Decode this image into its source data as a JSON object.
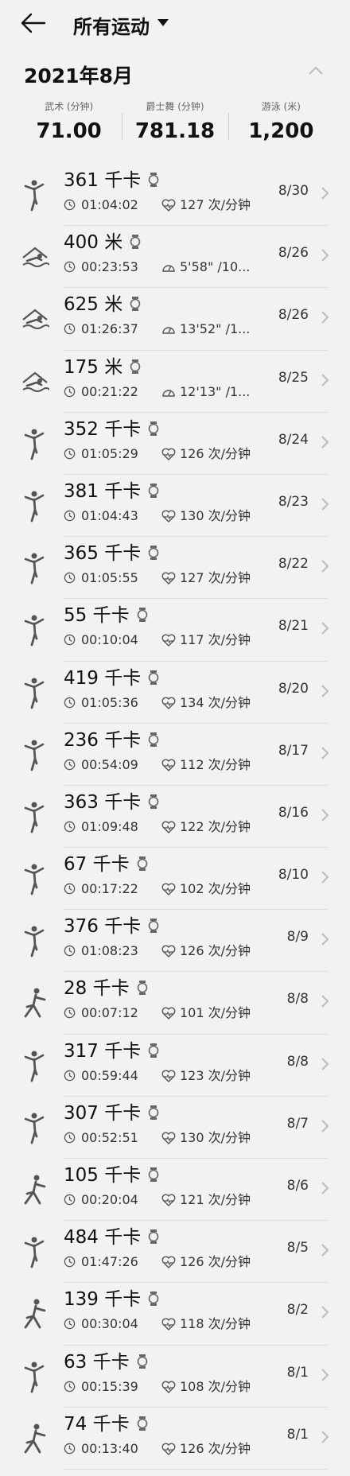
{
  "header": {
    "title": "所有运动",
    "back_icon": "arrow-left-icon",
    "dropdown_icon": "caret-down-icon"
  },
  "month": {
    "label": "2021年8月",
    "collapse_icon": "chevron-up-icon"
  },
  "summary": [
    {
      "label": "武术 (分钟)",
      "value": "71.00"
    },
    {
      "label": "爵士舞 (分钟)",
      "value": "781.18"
    },
    {
      "label": "游泳 (米)",
      "value": "1,200"
    }
  ],
  "records": [
    {
      "type": "dance",
      "metric": "361 千卡",
      "duration": "01:04:02",
      "secondary": "127 次/分钟",
      "date": "8/30"
    },
    {
      "type": "swim",
      "metric": "400 米",
      "duration": "00:23:53",
      "secondary": "5'58\" /10...",
      "date": "8/26"
    },
    {
      "type": "swim",
      "metric": "625 米",
      "duration": "01:26:37",
      "secondary": "13'52\" /1...",
      "date": "8/26"
    },
    {
      "type": "swim",
      "metric": "175 米",
      "duration": "00:21:22",
      "secondary": "12'13\" /1...",
      "date": "8/25"
    },
    {
      "type": "dance",
      "metric": "352 千卡",
      "duration": "01:05:29",
      "secondary": "126 次/分钟",
      "date": "8/24"
    },
    {
      "type": "dance",
      "metric": "381 千卡",
      "duration": "01:04:43",
      "secondary": "130 次/分钟",
      "date": "8/23"
    },
    {
      "type": "dance",
      "metric": "365 千卡",
      "duration": "01:05:55",
      "secondary": "127 次/分钟",
      "date": "8/22"
    },
    {
      "type": "dance",
      "metric": "55 千卡",
      "duration": "00:10:04",
      "secondary": "117 次/分钟",
      "date": "8/21"
    },
    {
      "type": "dance",
      "metric": "419 千卡",
      "duration": "01:05:36",
      "secondary": "134 次/分钟",
      "date": "8/20"
    },
    {
      "type": "dance",
      "metric": "236 千卡",
      "duration": "00:54:09",
      "secondary": "112 次/分钟",
      "date": "8/17"
    },
    {
      "type": "dance",
      "metric": "363 千卡",
      "duration": "01:09:48",
      "secondary": "122 次/分钟",
      "date": "8/16"
    },
    {
      "type": "dance",
      "metric": "67 千卡",
      "duration": "00:17:22",
      "secondary": "102 次/分钟",
      "date": "8/10"
    },
    {
      "type": "dance",
      "metric": "376 千卡",
      "duration": "01:08:23",
      "secondary": "126 次/分钟",
      "date": "8/9"
    },
    {
      "type": "martial",
      "metric": "28 千卡",
      "duration": "00:07:12",
      "secondary": "101 次/分钟",
      "date": "8/8"
    },
    {
      "type": "dance",
      "metric": "317 千卡",
      "duration": "00:59:44",
      "secondary": "123 次/分钟",
      "date": "8/8"
    },
    {
      "type": "dance",
      "metric": "307 千卡",
      "duration": "00:52:51",
      "secondary": "130 次/分钟",
      "date": "8/7"
    },
    {
      "type": "martial",
      "metric": "105 千卡",
      "duration": "00:20:04",
      "secondary": "121 次/分钟",
      "date": "8/6"
    },
    {
      "type": "dance",
      "metric": "484 千卡",
      "duration": "01:47:26",
      "secondary": "126 次/分钟",
      "date": "8/5"
    },
    {
      "type": "martial",
      "metric": "139 千卡",
      "duration": "00:30:04",
      "secondary": "118 次/分钟",
      "date": "8/2"
    },
    {
      "type": "dance",
      "metric": "63 千卡",
      "duration": "00:15:39",
      "secondary": "108 次/分钟",
      "date": "8/1"
    },
    {
      "type": "martial",
      "metric": "74 千卡",
      "duration": "00:13:40",
      "secondary": "126 次/分钟",
      "date": "8/1"
    }
  ]
}
